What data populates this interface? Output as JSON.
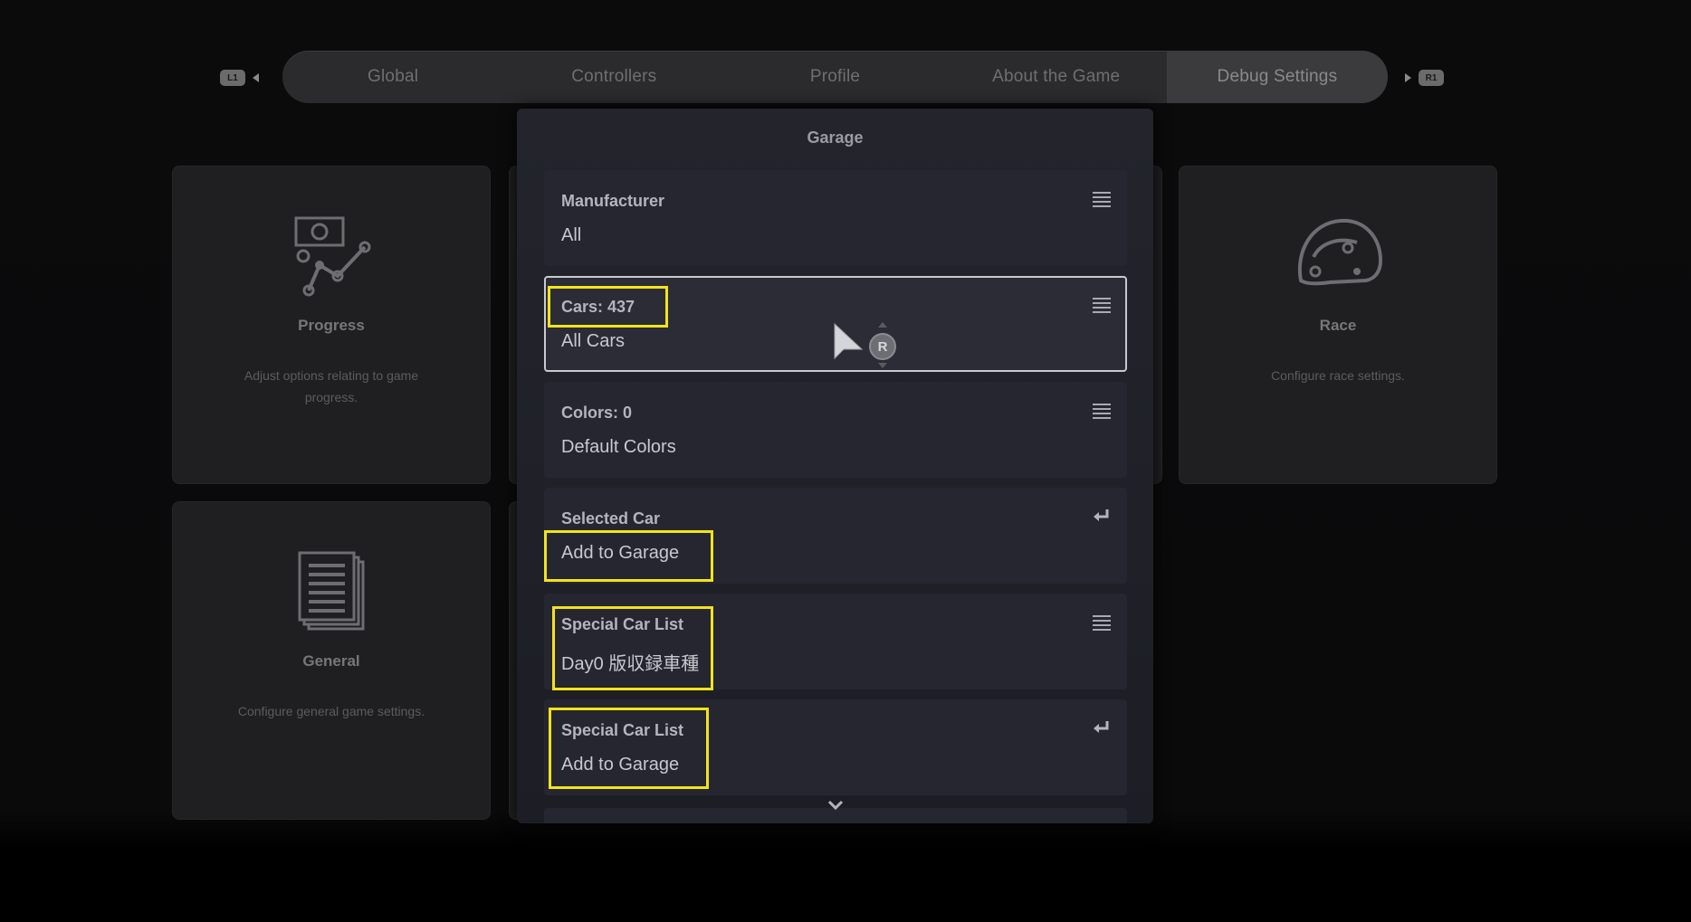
{
  "tabs": [
    {
      "label": "Global"
    },
    {
      "label": "Controllers"
    },
    {
      "label": "Profile"
    },
    {
      "label": "About the Game"
    },
    {
      "label": "Debug Settings",
      "active": true
    }
  ],
  "shoulder": {
    "left": "L1",
    "right": "R1"
  },
  "cards": {
    "progress": {
      "title": "Progress",
      "desc": "Adjust options relating to game progress.",
      "icon": "progress-chart-icon"
    },
    "race": {
      "title": "Race",
      "desc": "Configure race settings.",
      "icon": "helmet-icon"
    },
    "general": {
      "title": "General",
      "desc": "Configure general game settings.",
      "icon": "document-icon"
    }
  },
  "garage": {
    "title": "Garage",
    "rows": [
      {
        "label": "Manufacturer",
        "value": "All",
        "icon": "menu-icon"
      },
      {
        "label": "Cars: 437",
        "value": "All Cars",
        "icon": "menu-icon"
      },
      {
        "label": "Colors: 0",
        "value": "Default Colors",
        "icon": "menu-icon"
      },
      {
        "label": "Selected Car",
        "value": "Add to Garage",
        "icon": "enter-icon"
      },
      {
        "label": "Special Car List",
        "value": "Day0 版収録車種",
        "icon": "menu-icon"
      },
      {
        "label": "Special Car List",
        "value": "Add to Garage",
        "icon": "enter-icon"
      }
    ]
  },
  "cursor": {
    "badge": "R"
  },
  "colors": {
    "highlight": "#f2e31a",
    "panel": "#23242c",
    "background": "#0b0b0c"
  }
}
